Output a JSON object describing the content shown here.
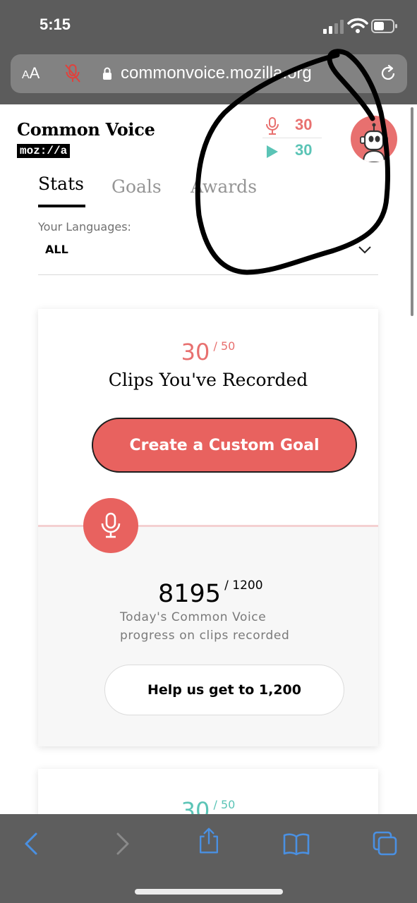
{
  "status_bar": {
    "time": "5:15"
  },
  "address_bar": {
    "text_size_label_small": "A",
    "text_size_label_big": "A",
    "url": "commonvoice.mozilla.org"
  },
  "header": {
    "brand": "Common Voice",
    "brand_sub": "moz://a",
    "recorded_count": "30",
    "validated_count": "30",
    "colors": {
      "record": "#e8706f",
      "validate": "#5bc4b6"
    }
  },
  "tabs": [
    {
      "label": "Stats",
      "active": true
    },
    {
      "label": "Goals",
      "active": false
    },
    {
      "label": "Awards",
      "active": false
    }
  ],
  "languages": {
    "label": "Your Languages:",
    "value": "ALL"
  },
  "record_card": {
    "count": "30",
    "goal": "/ 50",
    "title": "Clips You've Recorded",
    "button": "Create a Custom Goal",
    "progress_count": "8195",
    "progress_goal": "/ 1200",
    "progress_desc": "Today's Common Voice progress on clips recorded",
    "help_button": "Help us get to 1,200"
  },
  "validate_card": {
    "count": "30",
    "goal": "/ 50"
  }
}
